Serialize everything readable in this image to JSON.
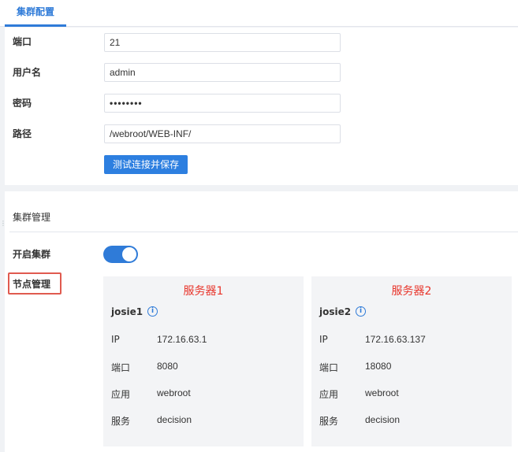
{
  "tabs": {
    "active_label": "集群配置"
  },
  "form": {
    "port_label": "端口",
    "port_value": "21",
    "username_label": "用户名",
    "username_value": "admin",
    "password_label": "密码",
    "password_value": "••••••••",
    "path_label": "路径",
    "path_value": "/webroot/WEB-INF/",
    "save_button": "测试连接并保存"
  },
  "cluster": {
    "section_title": "集群管理",
    "enable_label": "开启集群",
    "enabled": true,
    "node_mgmt_label": "节点管理",
    "servers": [
      {
        "title": "服务器1",
        "node": "josie1",
        "ip_label": "IP",
        "ip": "172.16.63.1",
        "port_label": "端口",
        "port": "8080",
        "app_label": "应用",
        "app": "webroot",
        "service_label": "服务",
        "service": "decision"
      },
      {
        "title": "服务器2",
        "node": "josie2",
        "ip_label": "IP",
        "ip": "172.16.63.137",
        "port_label": "端口",
        "port": "18080",
        "app_label": "应用",
        "app": "webroot",
        "service_label": "服务",
        "service": "decision"
      }
    ]
  },
  "colors": {
    "accent": "#2f7bd8",
    "server_title": "#e8342a",
    "highlight": "#e05a4f"
  },
  "icons": {
    "info": "info-circle-icon",
    "toggle": "toggle-switch"
  }
}
